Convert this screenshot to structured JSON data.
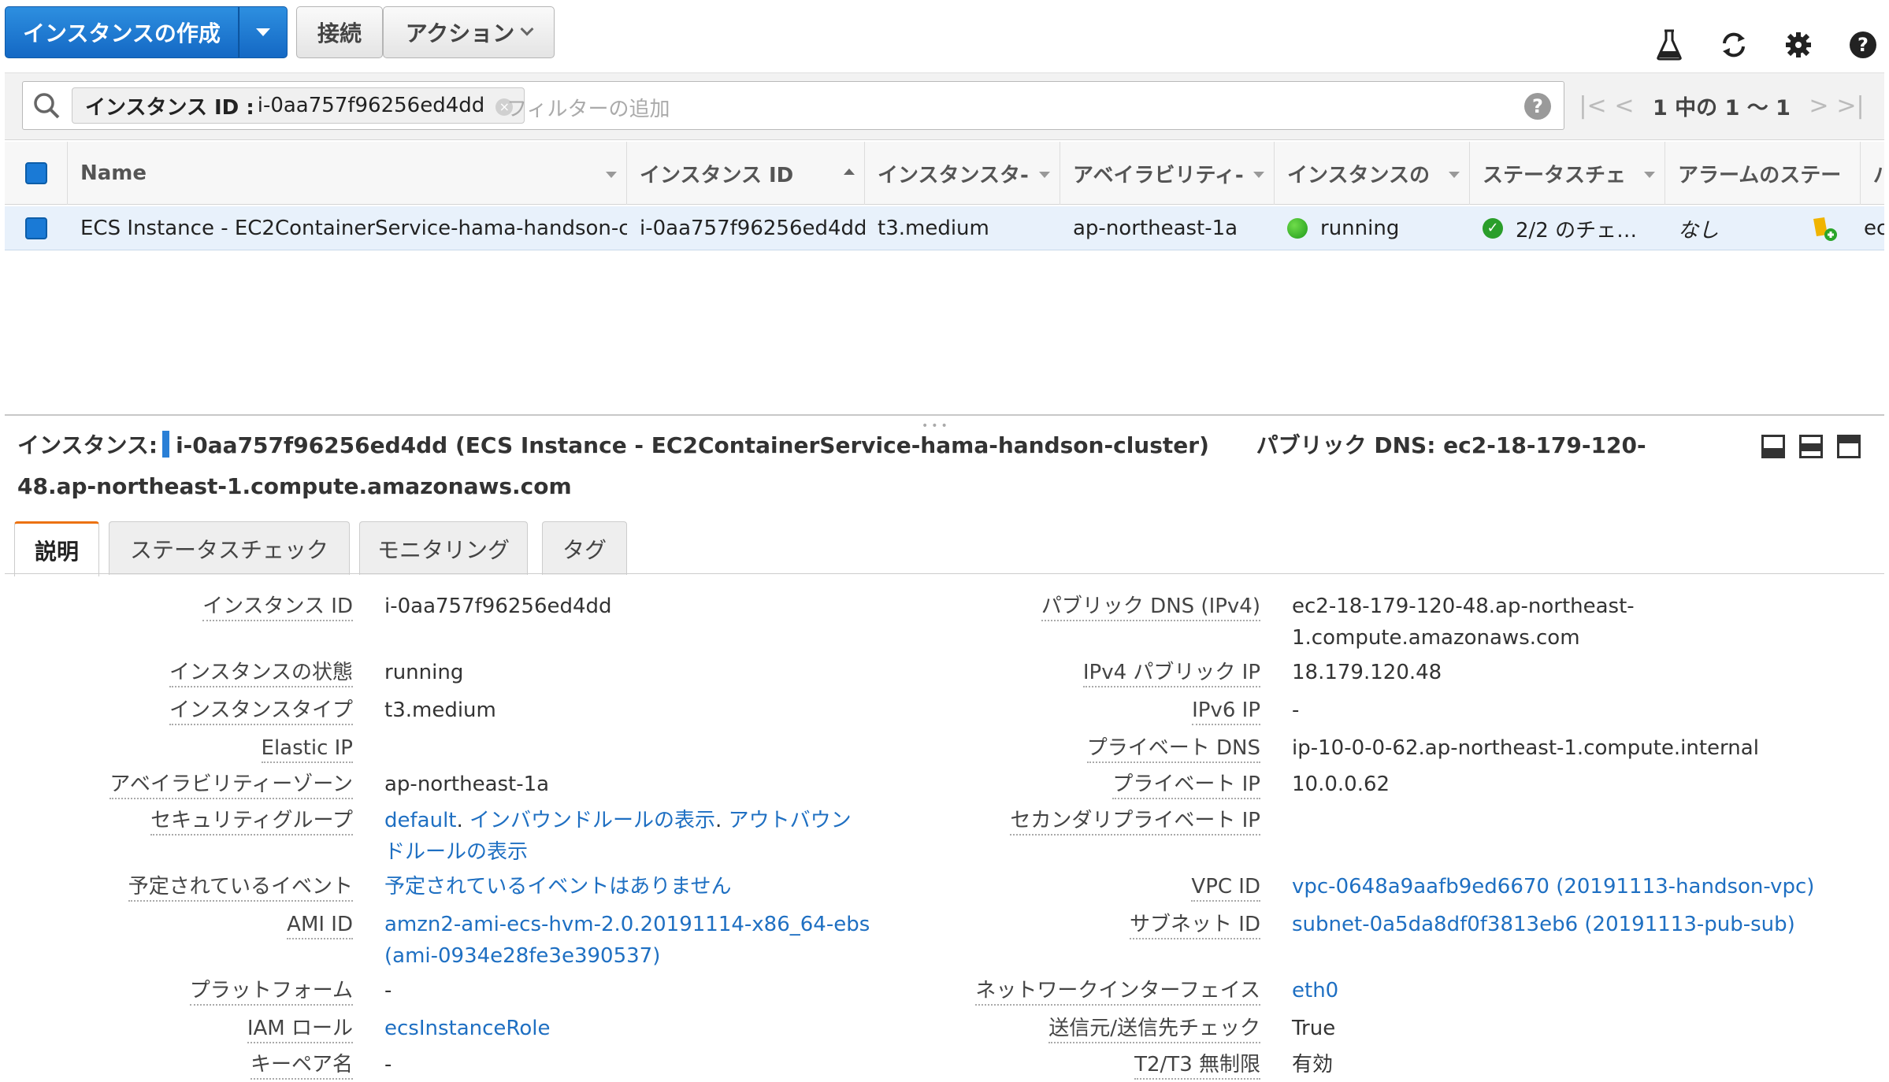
{
  "toolbar": {
    "create_label": "インスタンスの作成",
    "connect_label": "接続",
    "action_label": "アクション"
  },
  "filter": {
    "chip_key": "インスタンス ID :",
    "chip_value": "i-0aa757f96256ed4dd",
    "placeholder": "フィルターの追加",
    "pager_text": "1 中の 1 ～ 1"
  },
  "table": {
    "headers": [
      "Name",
      "インスタンス ID",
      "インスタンスタ-",
      "アベイラビリティ-",
      "インスタンスの",
      "ステータスチェ",
      "アラームのステー",
      "パ"
    ],
    "row": {
      "name": "ECS Instance - EC2ContainerService-hama-handson-c…",
      "instance_id": "i-0aa757f96256ed4dd",
      "type": "t3.medium",
      "az": "ap-northeast-1a",
      "state": "running",
      "status_check": "2/2 のチェ…",
      "alarm": "なし",
      "extra": "ec"
    }
  },
  "detail": {
    "title_prefix": "インスタンス:",
    "title_main": "i-0aa757f96256ed4dd (ECS Instance - EC2ContainerService-hama-handson-cluster)",
    "dns_label": "パブリック DNS:",
    "dns_value": "ec2-18-179-120-48.ap-northeast-1.compute.amazonaws.com",
    "tabs": [
      "説明",
      "ステータスチェック",
      "モニタリング",
      "タグ"
    ]
  },
  "left": {
    "instance_id_label": "インスタンス ID",
    "instance_id": "i-0aa757f96256ed4dd",
    "state_label": "インスタンスの状態",
    "state": "running",
    "type_label": "インスタンスタイプ",
    "type": "t3.medium",
    "eip_label": "Elastic IP",
    "az_label": "アベイラビリティーゾーン",
    "az": "ap-northeast-1a",
    "sg_label": "セキュリティグループ",
    "sg_default": "default",
    "sg_dot": ".",
    "sg_inbound": "インバウンドルールの表示",
    "sg_outbound_1": "アウトバウン",
    "sg_outbound_2": "ドルールの表示",
    "event_label": "予定されているイベント",
    "event": "予定されているイベントはありません",
    "ami_label": "AMI ID",
    "ami_1": "amzn2-ami-ecs-hvm-2.0.20191114-x86_64-ebs",
    "ami_2": "(ami-0934e28fe3e390537)",
    "platform_label": "プラットフォーム",
    "platform": "-",
    "iam_label": "IAM ロール",
    "iam": "ecsInstanceRole",
    "key_label": "キーペア名",
    "key": "-"
  },
  "right": {
    "pub_dns_label": "パブリック DNS (IPv4)",
    "pub_dns_1": "ec2-18-179-120-48.ap-northeast-",
    "pub_dns_2": "1.compute.amazonaws.com",
    "ipv4_label": "IPv4 パブリック IP",
    "ipv4": "18.179.120.48",
    "ipv6_label": "IPv6 IP",
    "ipv6": "-",
    "priv_dns_label": "プライベート DNS",
    "priv_dns": "ip-10-0-0-62.ap-northeast-1.compute.internal",
    "priv_ip_label": "プライベート IP",
    "priv_ip": "10.0.0.62",
    "sec_priv_label": "セカンダリプライベート IP",
    "vpc_label": "VPC ID",
    "vpc": "vpc-0648a9aafb9ed6670 (20191113-handson-vpc)",
    "subnet_label": "サブネット ID",
    "subnet": "subnet-0a5da8df0f3813eb6 (20191113-pub-sub)",
    "eni_label": "ネットワークインターフェイス",
    "eni": "eth0",
    "srcdst_label": "送信元/送信先チェック",
    "srcdst": "True",
    "t2t3_label": "T2/T3 無制限",
    "t2t3": "有効"
  },
  "colors": {
    "primary": "#1468c4",
    "link": "#1e6fc2",
    "active_tab": "#ec7211",
    "row_selected": "#e8f1fb"
  }
}
